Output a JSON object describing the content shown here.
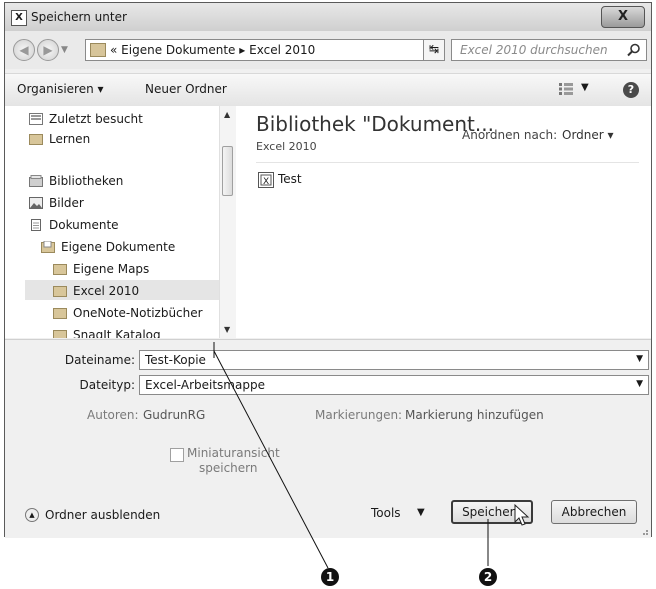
{
  "window": {
    "title": "Speichern unter",
    "close_label": "X"
  },
  "address": {
    "prefix": "«",
    "crumb1": "Eigene Dokumente",
    "separator": "▸",
    "crumb2": "Excel 2010",
    "dropdown": "▾"
  },
  "search": {
    "placeholder": "Excel 2010 durchsuchen"
  },
  "toolbar": {
    "organize": "Organisieren ▾",
    "new_folder": "Neuer Ordner"
  },
  "sidebar": {
    "items": [
      {
        "label": "Zuletzt besucht"
      },
      {
        "label": "Lernen"
      },
      {
        "label": "Bibliotheken"
      },
      {
        "label": "Bilder"
      },
      {
        "label": "Dokumente"
      },
      {
        "label": "Eigene Dokumente"
      },
      {
        "label": "Eigene Maps"
      },
      {
        "label": "Excel 2010"
      },
      {
        "label": "OneNote-Notizbücher"
      },
      {
        "label": "SnagIt Katalog"
      }
    ],
    "selected_index": 7
  },
  "content": {
    "library_title": "Bibliothek \"Dokument...",
    "library_subtitle": "Excel 2010",
    "arrange_label": "Anordnen nach:",
    "arrange_value": "Ordner ▾",
    "files": [
      {
        "name": "Test"
      }
    ]
  },
  "form": {
    "filename_label": "Dateiname:",
    "filename_value": "Test-Kopie",
    "filetype_label": "Dateityp:",
    "filetype_value": "Excel-Arbeitsmappe",
    "authors_label": "Autoren:",
    "authors_value": "GudrunRG",
    "tags_label": "Markierungen:",
    "tags_value": "Markierung hinzufügen",
    "thumbnail_label_line1": "Miniaturansicht",
    "thumbnail_label_line2": "speichern",
    "thumbnail_checked": false
  },
  "footer": {
    "hide_folders": "Ordner ausblenden",
    "tools": "Tools",
    "save": "Speichern",
    "cancel": "Abbrechen"
  },
  "annotations": {
    "one": "1",
    "two": "2"
  }
}
